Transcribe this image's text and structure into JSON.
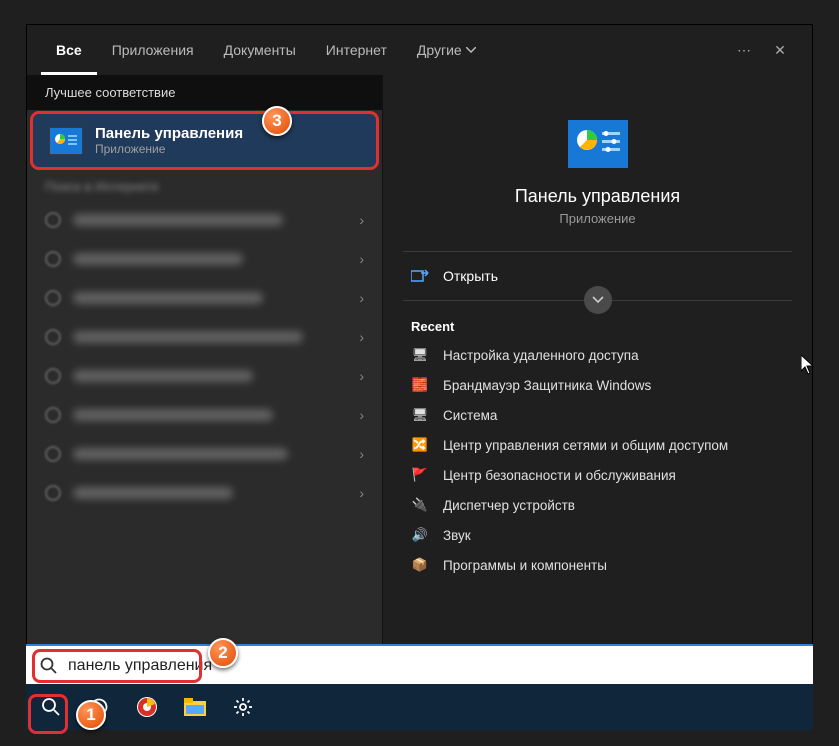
{
  "tabs": {
    "all": "Все",
    "apps": "Приложения",
    "docs": "Документы",
    "internet": "Интернет",
    "more": "Другие"
  },
  "left": {
    "section": "Лучшее соответствие",
    "primary": {
      "title": "Панель управления",
      "subtitle": "Приложение"
    },
    "web_section": "Поиск в Интернете"
  },
  "preview": {
    "title": "Панель управления",
    "subtitle": "Приложение",
    "open": "Открыть",
    "recent_label": "Recent",
    "recent": [
      {
        "icon": "🖥",
        "label": "Настройка удаленного доступа",
        "name": "recent-remote-access"
      },
      {
        "icon": "🧱",
        "label": "Брандмауэр Защитника Windows",
        "name": "recent-firewall"
      },
      {
        "icon": "🖥",
        "label": "Система",
        "name": "recent-system"
      },
      {
        "icon": "🔀",
        "label": "Центр управления сетями и общим доступом",
        "name": "recent-network-center"
      },
      {
        "icon": "🚩",
        "label": "Центр безопасности и обслуживания",
        "name": "recent-security-center"
      },
      {
        "icon": "🔌",
        "label": "Диспетчер устройств",
        "name": "recent-device-manager"
      },
      {
        "icon": "🔊",
        "label": "Звук",
        "name": "recent-sound"
      },
      {
        "icon": "📦",
        "label": "Программы и компоненты",
        "name": "recent-programs"
      }
    ]
  },
  "search": {
    "query": "панель управления"
  },
  "markers": {
    "m1": "1",
    "m2": "2",
    "m3": "3"
  },
  "more_dots": "⋯",
  "close": "✕"
}
